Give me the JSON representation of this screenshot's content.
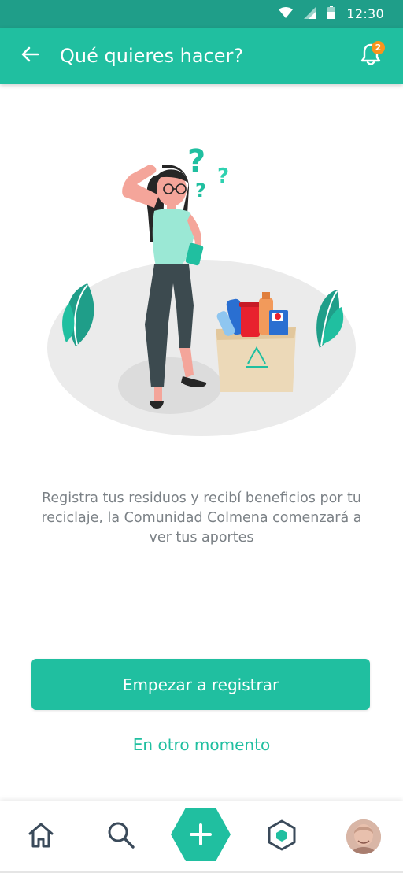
{
  "status_bar": {
    "time": "12:30",
    "icons": [
      "wifi-icon",
      "signal-icon",
      "battery-icon"
    ]
  },
  "app_bar": {
    "back_icon": "arrow-left-icon",
    "title": "Qué quieres hacer?",
    "notifications_icon": "bell-icon",
    "notifications_count": "2"
  },
  "illustration": {
    "subject": "woman-thinking-recycling-illustration",
    "question_marks": [
      "?",
      "?",
      "?"
    ]
  },
  "main": {
    "description": "Registra tus residuos y recibí beneficios por tu reciclaje, la Comunidad Colmena comenzará a ver tus aportes",
    "primary_button": "Empezar a registrar",
    "secondary_link": "En otro momento"
  },
  "bottom_nav": {
    "items": [
      {
        "icon": "home-icon"
      },
      {
        "icon": "search-icon"
      },
      {
        "icon": "plus-icon"
      },
      {
        "icon": "exchange-icon"
      },
      {
        "icon": "avatar"
      }
    ]
  },
  "colors": {
    "status_bar": "#1f9e89",
    "accent": "#20bfa0",
    "badge": "#f7941d",
    "nav_icon": "#3a4a5a",
    "body_text": "#7b8186"
  }
}
